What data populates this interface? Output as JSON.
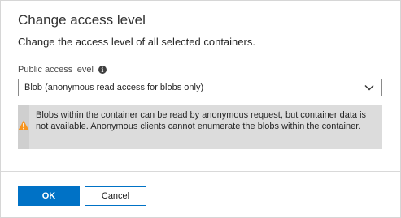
{
  "dialog": {
    "title": "Change access level",
    "subtitle": "Change the access level of all selected containers."
  },
  "public_access": {
    "label": "Public access level",
    "info_icon": "info-icon",
    "selected_value": "Blob (anonymous read access for blobs only)",
    "dropdown_icon": "chevron-down-icon"
  },
  "warning": {
    "icon": "warning-icon",
    "text": "Blobs within the container can be read by anonymous request, but container data is not available. Anonymous clients cannot enumerate the blobs within the container.",
    "icon_color": "#f7941d"
  },
  "buttons": {
    "ok_label": "OK",
    "cancel_label": "Cancel"
  },
  "colors": {
    "accent": "#0072c6",
    "warning_background": "#dcdcdc"
  }
}
